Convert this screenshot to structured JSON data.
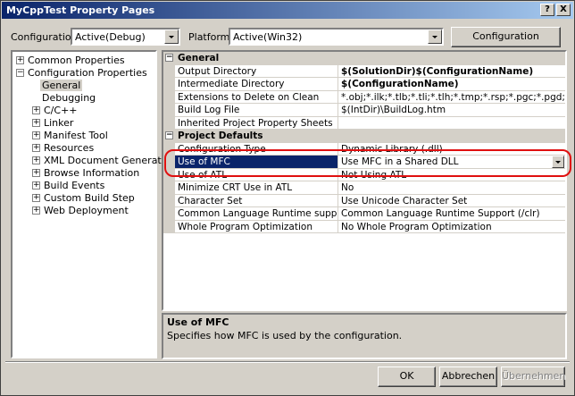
{
  "window": {
    "title": "MyCppTest Property Pages",
    "help_glyph": "?",
    "close_glyph": "X"
  },
  "toolbar": {
    "configuration_label": "Configuration:",
    "configuration_value": "Active(Debug)",
    "platform_label": "Platform:",
    "platform_value": "Active(Win32)",
    "config_manager_label": "Configuration Manager..."
  },
  "tree": {
    "items": [
      {
        "label": "Common Properties",
        "expander": "+"
      },
      {
        "label": "Configuration Properties",
        "expander": "−"
      },
      {
        "label": "General",
        "selected": true
      },
      {
        "label": "Debugging"
      },
      {
        "label": "C/C++",
        "expander": "+"
      },
      {
        "label": "Linker",
        "expander": "+"
      },
      {
        "label": "Manifest Tool",
        "expander": "+"
      },
      {
        "label": "Resources",
        "expander": "+"
      },
      {
        "label": "XML Document Generator",
        "expander": "+"
      },
      {
        "label": "Browse Information",
        "expander": "+"
      },
      {
        "label": "Build Events",
        "expander": "+"
      },
      {
        "label": "Custom Build Step",
        "expander": "+"
      },
      {
        "label": "Web Deployment",
        "expander": "+"
      }
    ]
  },
  "grid": {
    "sections": [
      {
        "title": "General",
        "expander": "−",
        "rows": [
          {
            "name": "Output Directory",
            "value": "$(SolutionDir)$(ConfigurationName)",
            "bold": true
          },
          {
            "name": "Intermediate Directory",
            "value": "$(ConfigurationName)",
            "bold": true
          },
          {
            "name": "Extensions to Delete on Clean",
            "value": "*.obj;*.ilk;*.tlb;*.tli;*.tlh;*.tmp;*.rsp;*.pgc;*.pgd;$(TargetPath)"
          },
          {
            "name": "Build Log File",
            "value": "$(IntDir)\\BuildLog.htm"
          },
          {
            "name": "Inherited Project Property Sheets",
            "value": ""
          }
        ]
      },
      {
        "title": "Project Defaults",
        "expander": "−",
        "rows": [
          {
            "name": "Configuration Type",
            "value": "Dynamic Library (.dll)"
          },
          {
            "name": "Use of MFC",
            "value": "Use MFC in a Shared DLL",
            "selected": true
          },
          {
            "name": "Use of ATL",
            "value": "Not Using ATL"
          },
          {
            "name": "Minimize CRT Use in ATL",
            "value": "No"
          },
          {
            "name": "Character Set",
            "value": "Use Unicode Character Set"
          },
          {
            "name": "Common Language Runtime support",
            "value": "Common Language Runtime Support (/clr)"
          },
          {
            "name": "Whole Program Optimization",
            "value": "No Whole Program Optimization"
          }
        ]
      }
    ]
  },
  "description": {
    "title": "Use of MFC",
    "text": "Specifies how MFC is used by the configuration."
  },
  "buttons": {
    "ok": "OK",
    "cancel": "Abbrechen",
    "apply": "Übernehmen"
  }
}
